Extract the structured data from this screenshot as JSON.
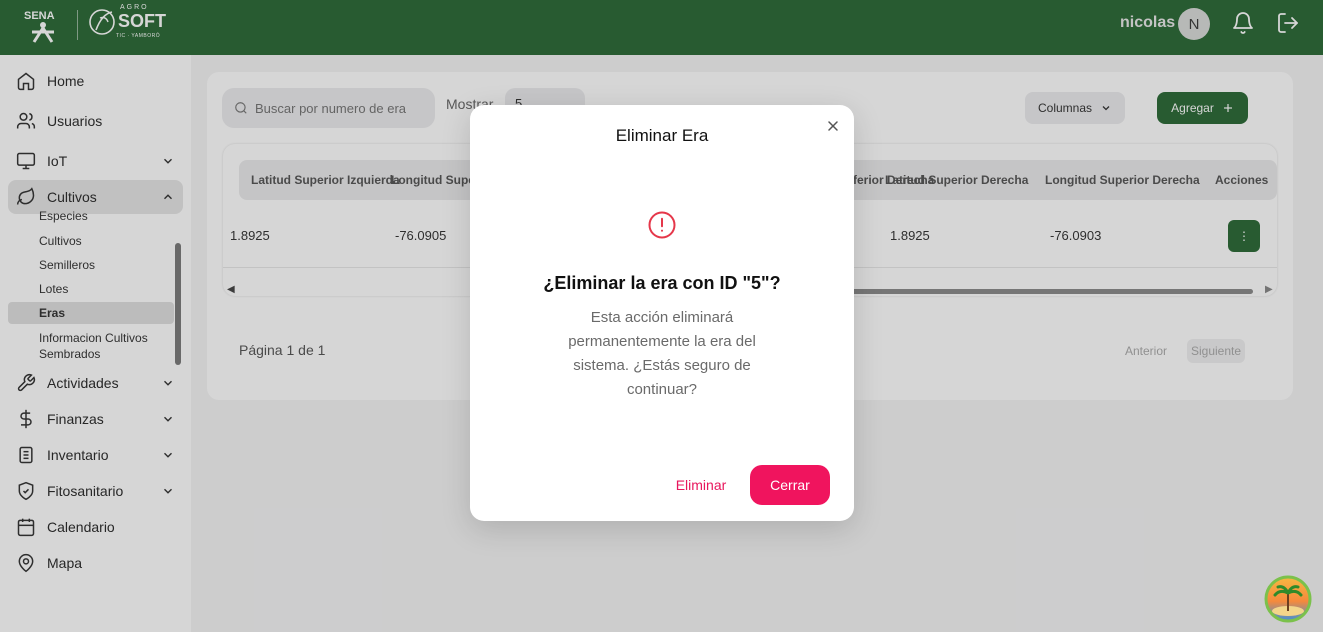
{
  "header": {
    "logo_sena_text": "SENA",
    "logo_agro_small": "AGRO",
    "logo_agro_big": "SOFT",
    "logo_agro_tiny": "TIC · YAMBORÓ",
    "user_name": "nicolas",
    "avatar_initial": "N"
  },
  "sidebar": {
    "items": [
      {
        "label": "Home",
        "icon": "home-icon"
      },
      {
        "label": "Usuarios",
        "icon": "users-icon"
      },
      {
        "label": "IoT",
        "icon": "monitor-icon"
      },
      {
        "label": "Cultivos",
        "icon": "leaf-icon"
      },
      {
        "label": "Actividades",
        "icon": "tool-icon"
      },
      {
        "label": "Finanzas",
        "icon": "dollar-icon"
      },
      {
        "label": "Inventario",
        "icon": "clipboard-icon"
      },
      {
        "label": "Fitosanitario",
        "icon": "shield-icon"
      },
      {
        "label": "Calendario",
        "icon": "calendar-icon"
      },
      {
        "label": "Mapa",
        "icon": "map-pin-icon"
      }
    ],
    "cultivos_sub": [
      "Especies",
      "Cultivos",
      "Semilleros",
      "Lotes",
      "Eras",
      "Informacion Cultivos Sembrados"
    ]
  },
  "toolbar": {
    "search_placeholder": "Buscar por numero de era",
    "mostrar_label": "Mostrar",
    "mostrar_value": "5",
    "columnas_label": "Columnas",
    "agregar_label": "Agregar"
  },
  "table": {
    "headers": [
      "Latitud Superior Izquierda",
      "Longitud Superior Izquierda",
      "Latitud Inferior Derecha",
      "Latitud Superior Derecha",
      "Longitud Superior Derecha",
      "Acciones"
    ],
    "row": {
      "c1": "1.8925",
      "c2": "-76.0905",
      "c3": "1.8925",
      "c4": "-76.0903"
    },
    "action_label": "⋮"
  },
  "pagination": {
    "label": "Página 1 de 1",
    "prev": "Anterior",
    "next": "Siguiente"
  },
  "modal": {
    "title": "Eliminar Era",
    "heading": "¿Eliminar la era con ID \"5\"?",
    "text": "Esta acción eliminará permanentemente la era del sistema. ¿Estás seguro de continuar?",
    "delete_label": "Eliminar",
    "close_label": "Cerrar"
  },
  "colors": {
    "brand_green": "#2b6a36",
    "danger_pink": "#f0145e"
  }
}
